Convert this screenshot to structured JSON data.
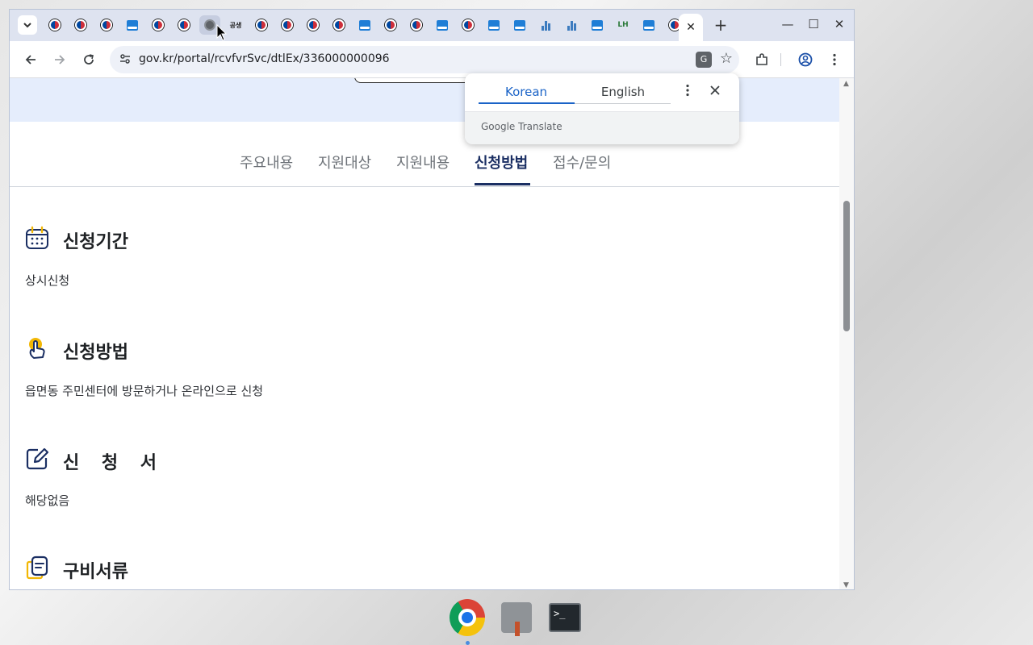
{
  "browser": {
    "url": "gov.kr/portal/rcvfvrSvc/dtlEx/336000000096",
    "new_tab_symbol": "+",
    "window_controls": {
      "minimize": "—",
      "maximize": "☐",
      "close": "✕"
    },
    "tab_close_symbol": "✕",
    "tabs": [
      {
        "icon": "flag-favicon"
      },
      {
        "icon": "flag-favicon"
      },
      {
        "icon": "flag-favicon"
      },
      {
        "icon": "gov24-favicon"
      },
      {
        "icon": "flag-favicon"
      },
      {
        "icon": "flag-favicon"
      },
      {
        "icon": "globe-favicon"
      },
      {
        "icon": "gw-favicon",
        "text": "공생"
      },
      {
        "icon": "flag-favicon"
      },
      {
        "icon": "flag-favicon"
      },
      {
        "icon": "flag-favicon"
      },
      {
        "icon": "flag-favicon"
      },
      {
        "icon": "gov24-favicon"
      },
      {
        "icon": "flag-favicon"
      },
      {
        "icon": "flag-favicon"
      },
      {
        "icon": "gov24-favicon"
      },
      {
        "icon": "flag-favicon"
      },
      {
        "icon": "gov24-favicon"
      },
      {
        "icon": "gov24-favicon"
      },
      {
        "icon": "bars-favicon"
      },
      {
        "icon": "bars-favicon"
      },
      {
        "icon": "gov24-favicon"
      },
      {
        "icon": "lh-favicon",
        "text": "LH"
      },
      {
        "icon": "gov24-favicon"
      },
      {
        "icon": "flag-favicon"
      },
      {
        "icon": "flag-favicon",
        "active": true
      }
    ]
  },
  "page": {
    "nav_tabs": [
      {
        "label": "주요내용",
        "active": false
      },
      {
        "label": "지원대상",
        "active": false
      },
      {
        "label": "지원내용",
        "active": false
      },
      {
        "label": "신청방법",
        "active": true
      },
      {
        "label": "접수/문의",
        "active": false
      }
    ],
    "sections": [
      {
        "icon": "calendar-icon",
        "title": "신청기간",
        "body": "상시신청"
      },
      {
        "icon": "hand-pointer-icon",
        "title": "신청방법",
        "body": "읍면동 주민센터에 방문하거나 온라인으로 신청"
      },
      {
        "icon": "edit-form-icon",
        "title": "신 청 서",
        "body": "해당없음"
      },
      {
        "icon": "documents-icon",
        "title": "구비서류",
        "body": ""
      }
    ]
  },
  "translate_popup": {
    "tabs": [
      "Korean",
      "English"
    ],
    "active_tab": "Korean",
    "brand": "Google Translate"
  },
  "taskbar": {
    "items": [
      "chrome-icon",
      "tool-icon",
      "terminal-icon"
    ],
    "terminal_text": ">_"
  },
  "colors": {
    "accent": "#1b2f63",
    "translate_accent": "#1a63c7",
    "hero_bg": "#e5edfc",
    "tabstrip_bg": "#dee3f0"
  }
}
